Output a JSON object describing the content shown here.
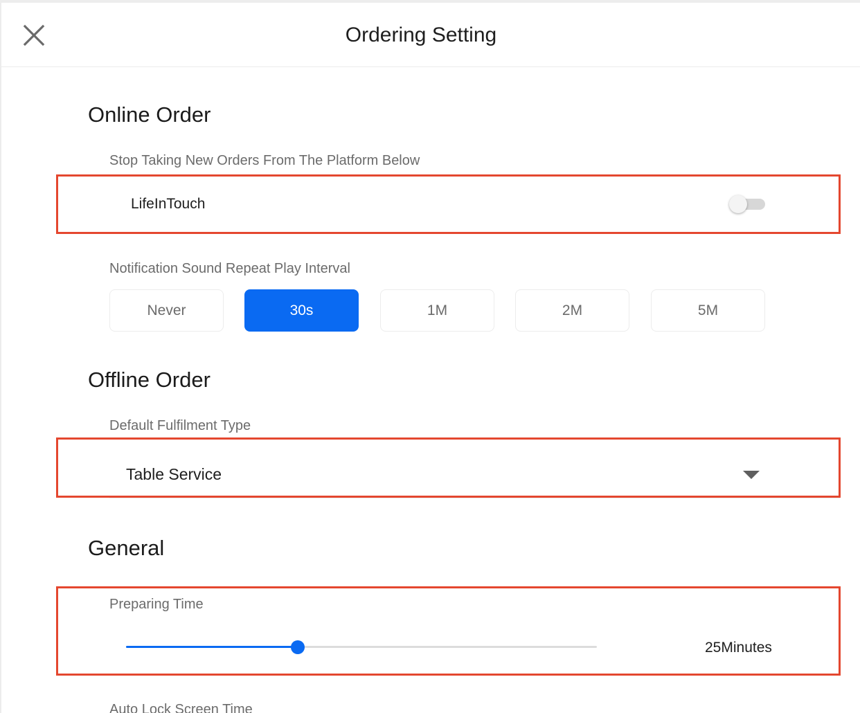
{
  "header": {
    "title": "Ordering Setting"
  },
  "online_order": {
    "title": "Online Order",
    "stop_label": "Stop Taking New Orders From The Platform Below",
    "platform": {
      "name": "LifeInTouch",
      "enabled": false
    },
    "interval_label": "Notification Sound Repeat Play Interval",
    "intervals": [
      "Never",
      "30s",
      "1M",
      "2M",
      "5M"
    ],
    "selected_interval": "30s"
  },
  "offline_order": {
    "title": "Offline Order",
    "fulfilment_label": "Default Fulfilment Type",
    "fulfilment_value": "Table Service"
  },
  "general": {
    "title": "General",
    "preparing_label": "Preparing Time",
    "preparing_value": "25Minutes",
    "preparing_fraction": 0.365,
    "autolock_label": "Auto Lock Screen Time"
  },
  "colors": {
    "accent": "#0a6af2",
    "highlight_border": "#e4472f",
    "toggle_track_off": "#d7d7d7"
  }
}
